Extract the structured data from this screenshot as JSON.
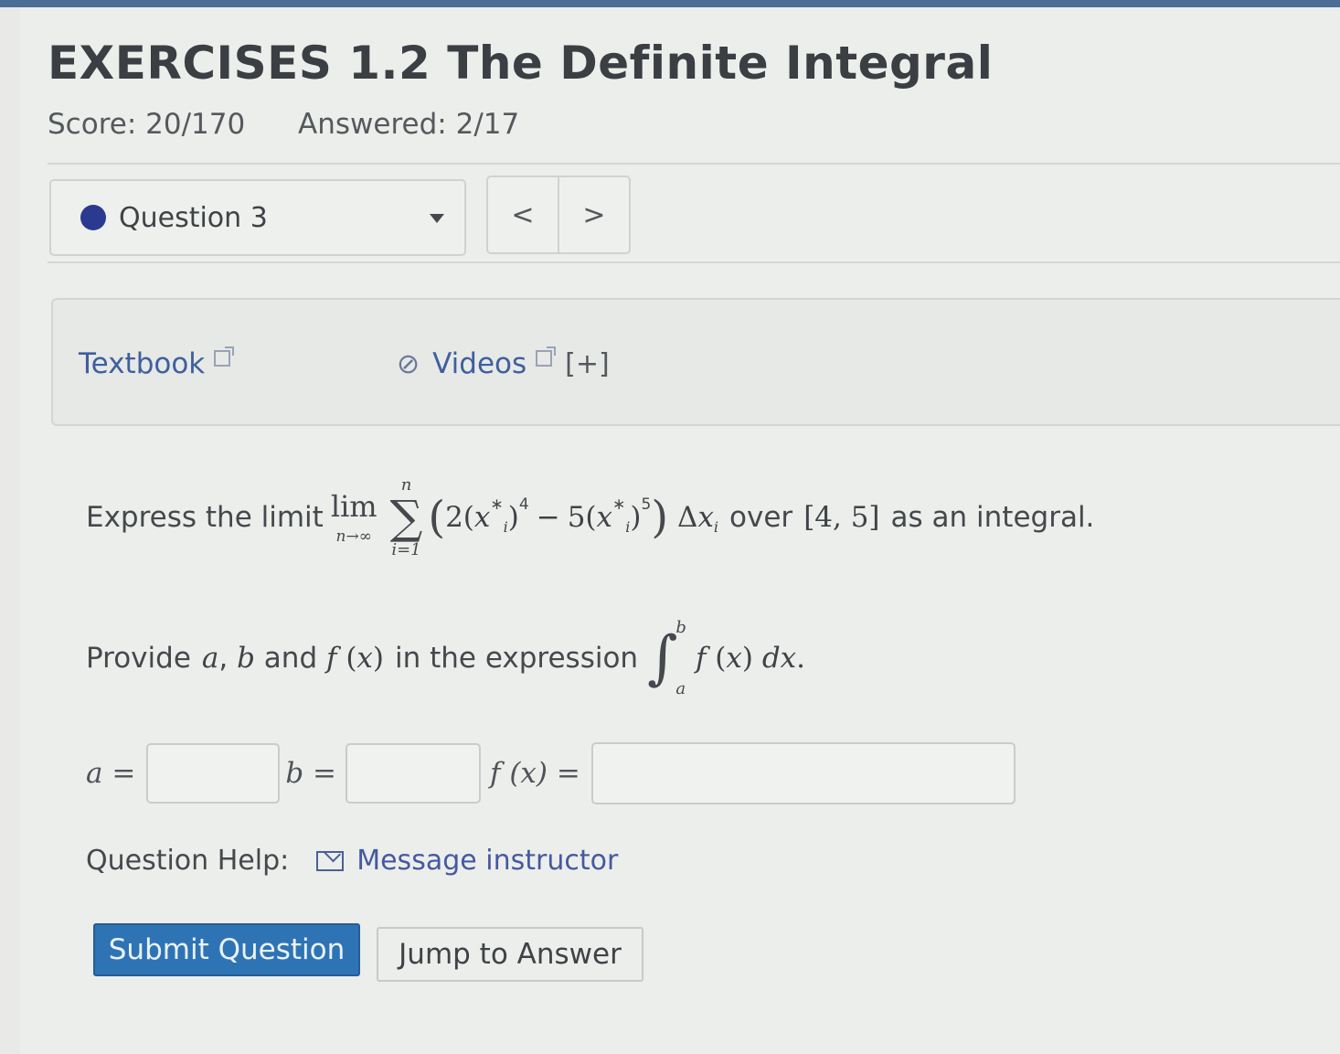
{
  "header": {
    "title": "EXERCISES 1.2 The Definite Integral",
    "score": "Score: 20/170",
    "answered": "Answered: 2/17"
  },
  "question_nav": {
    "selected": "Question 3",
    "prev": "<",
    "next": ">"
  },
  "resources": {
    "textbook": "Textbook",
    "videos": "Videos",
    "expand": "[+]"
  },
  "problem": {
    "prompt_start": "Express the limit",
    "lim": "lim",
    "lim_sub": "n→∞",
    "sum_top": "n",
    "sum_bottom": "i=1",
    "summand": "(2(x",
    "over_text": "over",
    "interval": "[4, 5]",
    "prompt_end": "as an integral.",
    "provide_start": "Provide",
    "provide_mid": "in the expression",
    "int_upper": "b",
    "int_lower": "a"
  },
  "answers": {
    "a_label": "a =",
    "b_label": "b =",
    "f_label": "f (x) =",
    "a_value": "",
    "b_value": "",
    "f_value": ""
  },
  "help": {
    "label": "Question Help:",
    "message": "Message instructor"
  },
  "buttons": {
    "submit": "Submit Question",
    "jump": "Jump to Answer"
  }
}
